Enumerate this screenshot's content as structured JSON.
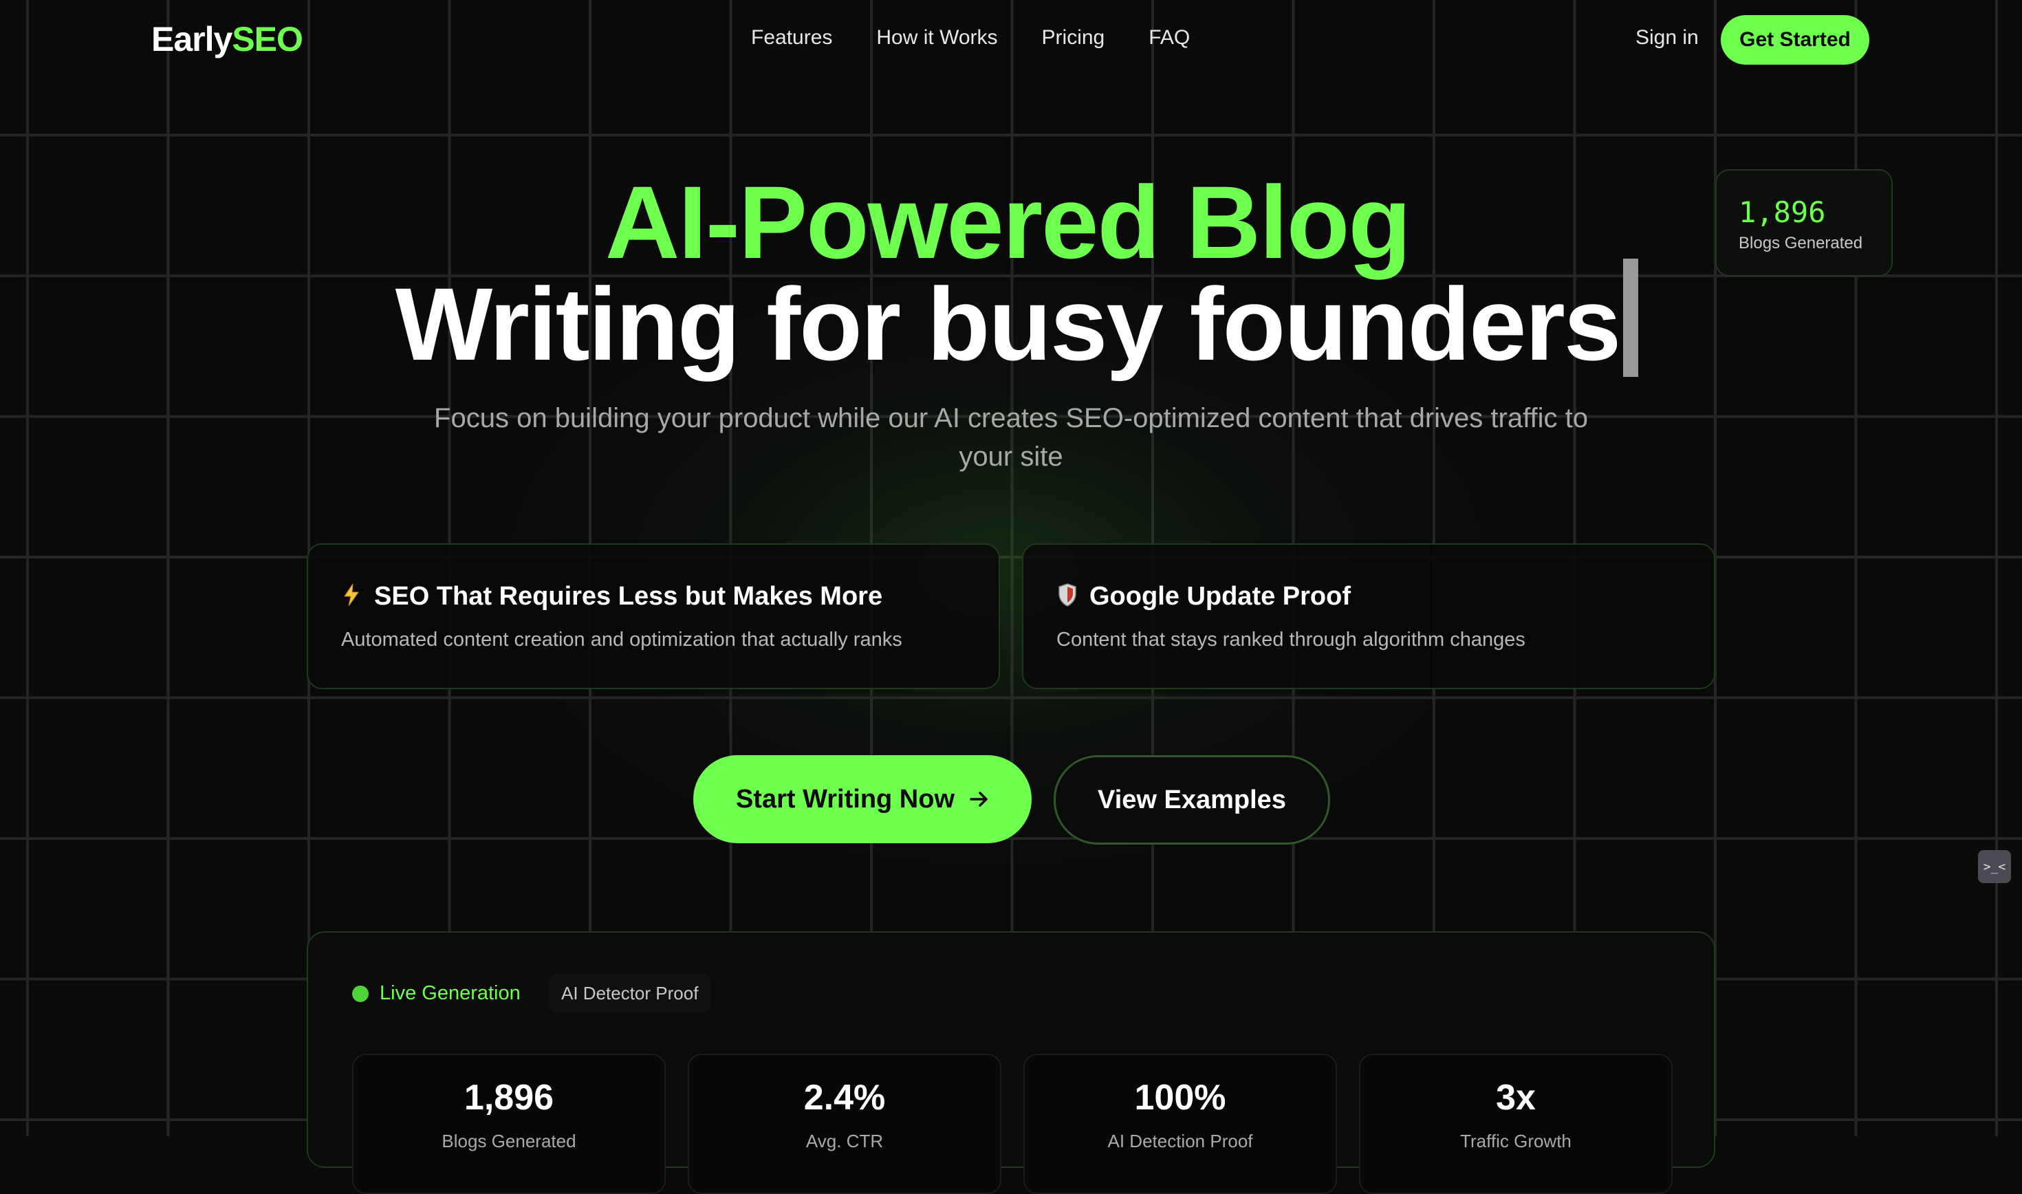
{
  "nav": {
    "logo_part1": "Early",
    "logo_part2": "SEO",
    "links": [
      "Features",
      "How it Works",
      "Pricing",
      "FAQ"
    ],
    "sign_in": "Sign in",
    "get_started": "Get Started"
  },
  "counter": {
    "value": "1,896",
    "label": "Blogs Generated"
  },
  "hero": {
    "headline_line1": "AI-Powered Blog",
    "headline_line2": "Writing for busy founders",
    "subtitle": "Focus on building your product while our AI creates SEO-optimized content that drives traffic to your site"
  },
  "features": [
    {
      "icon": "lightning-icon",
      "title": "SEO That Requires Less but Makes More",
      "desc": "Automated content creation and optimization that actually ranks"
    },
    {
      "icon": "shield-icon",
      "title": "Google Update Proof",
      "desc": "Content that stays ranked through algorithm changes"
    }
  ],
  "cta": {
    "primary": "Start Writing Now",
    "secondary": "View Examples"
  },
  "panel": {
    "live_label": "Live Generation",
    "badge": "AI Detector Proof",
    "stats": [
      {
        "value": "1,896",
        "label": "Blogs Generated"
      },
      {
        "value": "2.4%",
        "label": "Avg. CTR"
      },
      {
        "value": "100%",
        "label": "AI Detection Proof"
      },
      {
        "value": "3x",
        "label": "Traffic Growth"
      }
    ]
  },
  "colors": {
    "accent": "#6eff4f",
    "background": "#0a0a0a"
  }
}
